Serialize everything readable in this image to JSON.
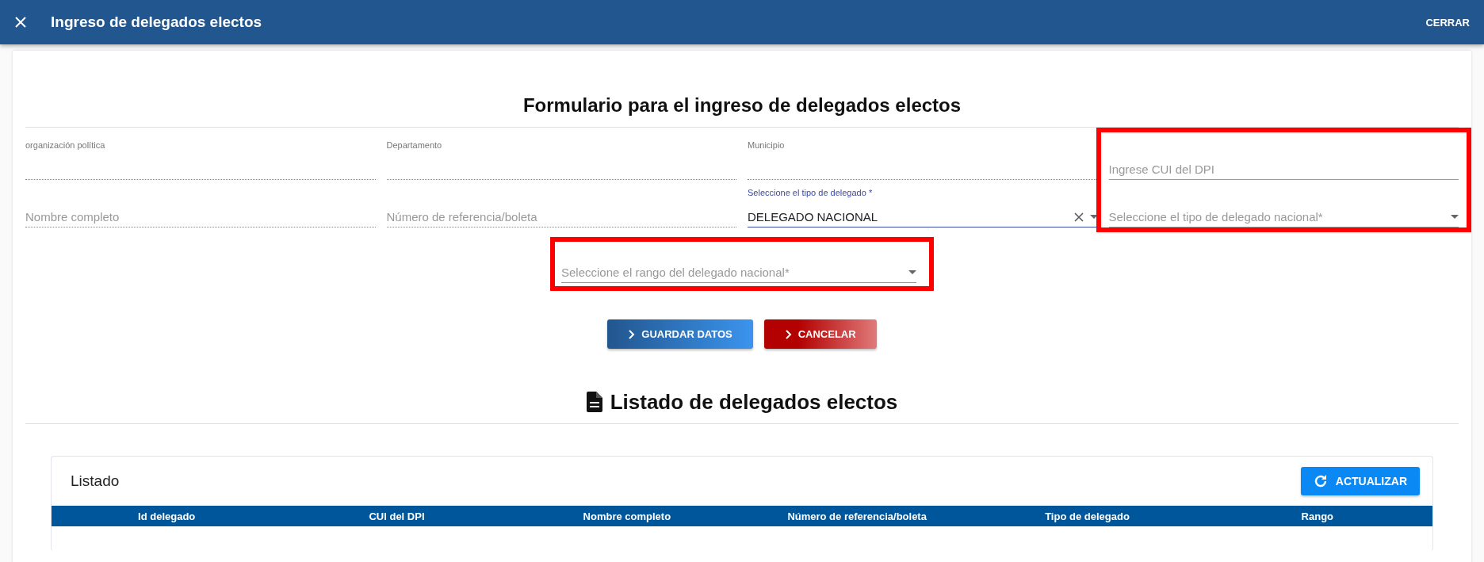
{
  "header": {
    "title": "Ingreso de delegados electos",
    "close_action": "CERRAR"
  },
  "form": {
    "title": "Formulario para el ingreso de delegados electos",
    "columns": [
      {
        "highlighted": false,
        "fields": [
          {
            "kind": "text",
            "label": "organización política",
            "disabled": true
          },
          {
            "kind": "text",
            "placeholder": "Nombre completo",
            "disabled": true
          }
        ]
      },
      {
        "highlighted": false,
        "fields": [
          {
            "kind": "text",
            "label": "Departamento",
            "disabled": true
          },
          {
            "kind": "text",
            "placeholder": "Número de referencia/boleta",
            "disabled": true
          }
        ]
      },
      {
        "highlighted": false,
        "fields": [
          {
            "kind": "text",
            "label": "Municipio",
            "disabled": true
          },
          {
            "kind": "select",
            "label": "Seleccione el tipo de delegado *",
            "value": "DELEGADO NACIONAL",
            "focused": true,
            "clearable": true
          }
        ]
      },
      {
        "highlighted": true,
        "fields": [
          {
            "kind": "text",
            "placeholder": "Ingrese CUI del DPI",
            "disabled": false
          },
          {
            "kind": "select",
            "placeholder": "Seleccione el tipo de delegado nacional*",
            "focused": false,
            "clearable": false
          }
        ]
      }
    ],
    "extra": {
      "highlighted": true,
      "field": {
        "kind": "select",
        "placeholder": "Seleccione el rango del delegado nacional*",
        "focused": false,
        "clearable": false
      }
    },
    "buttons": [
      {
        "kind": "primary",
        "label": "GUARDAR DATOS"
      },
      {
        "kind": "danger",
        "label": "CANCELAR"
      }
    ]
  },
  "listing": {
    "title": "Listado de delegados electos",
    "panel_title": "Listado",
    "refresh_button": "ACTUALIZAR",
    "columns": [
      "Id delegado",
      "CUI del DPI",
      "Nombre completo",
      "Número de referencia/boleta",
      "Tipo de delegado",
      "Rango"
    ]
  }
}
